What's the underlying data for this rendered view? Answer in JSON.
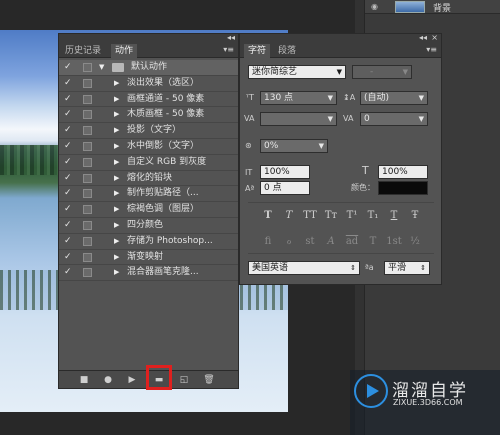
{
  "layers_panel": {
    "layer_name": "背景"
  },
  "actions_panel": {
    "tabs": [
      {
        "label": "历史记录"
      },
      {
        "label": "动作"
      }
    ],
    "collapse_glyph": "◂◂",
    "menu_glyph": "▾≡",
    "rows": [
      {
        "label": "默认动作"
      },
      {
        "label": "淡出效果（选区）"
      },
      {
        "label": "画框通道 - 50 像素"
      },
      {
        "label": "木质画框 - 50 像素"
      },
      {
        "label": "投影（文字）"
      },
      {
        "label": "水中倒影（文字）"
      },
      {
        "label": "自定义 RGB 到灰度"
      },
      {
        "label": "熔化的铅块"
      },
      {
        "label": "制作剪贴路径（..."
      },
      {
        "label": "棕褐色调（图层）"
      },
      {
        "label": "四分颜色"
      },
      {
        "label": "存储为 Photoshop..."
      },
      {
        "label": "渐变映射"
      },
      {
        "label": "混合器画笔克隆..."
      }
    ],
    "footer_icons": [
      "stop-icon",
      "record-icon",
      "play-icon",
      "new-set-icon",
      "new-action-icon",
      "delete-icon"
    ]
  },
  "character_panel": {
    "tabs": [
      {
        "label": "字符"
      },
      {
        "label": "段落"
      }
    ],
    "collapse_glyph": "◂◂",
    "close_glyph": "×",
    "menu_glyph": "▾≡",
    "font_family": "迷你简综艺",
    "font_style": "-",
    "font_size": "130 点",
    "leading": "(自动)",
    "kerning": "",
    "tracking": "0",
    "tsume": "0%",
    "vertical_scale": "100%",
    "horizontal_scale": "100%",
    "baseline_shift": "0 点",
    "color_label": "颜色：",
    "text_color": "#0a0a0a",
    "language": "美国英语",
    "antialias_label": "ªa",
    "antialias": "平滑",
    "style_buttons": [
      "T",
      "T",
      "TT",
      "Tт",
      "T¹",
      "T₁",
      "T",
      "Ŧ"
    ],
    "opentype_buttons": [
      "fi",
      "ℴ",
      "st",
      "A",
      "ad",
      "T",
      "1st",
      "½"
    ]
  },
  "watermark": {
    "title": "溜溜自学",
    "url": "ZIXUE.3D66.COM"
  }
}
